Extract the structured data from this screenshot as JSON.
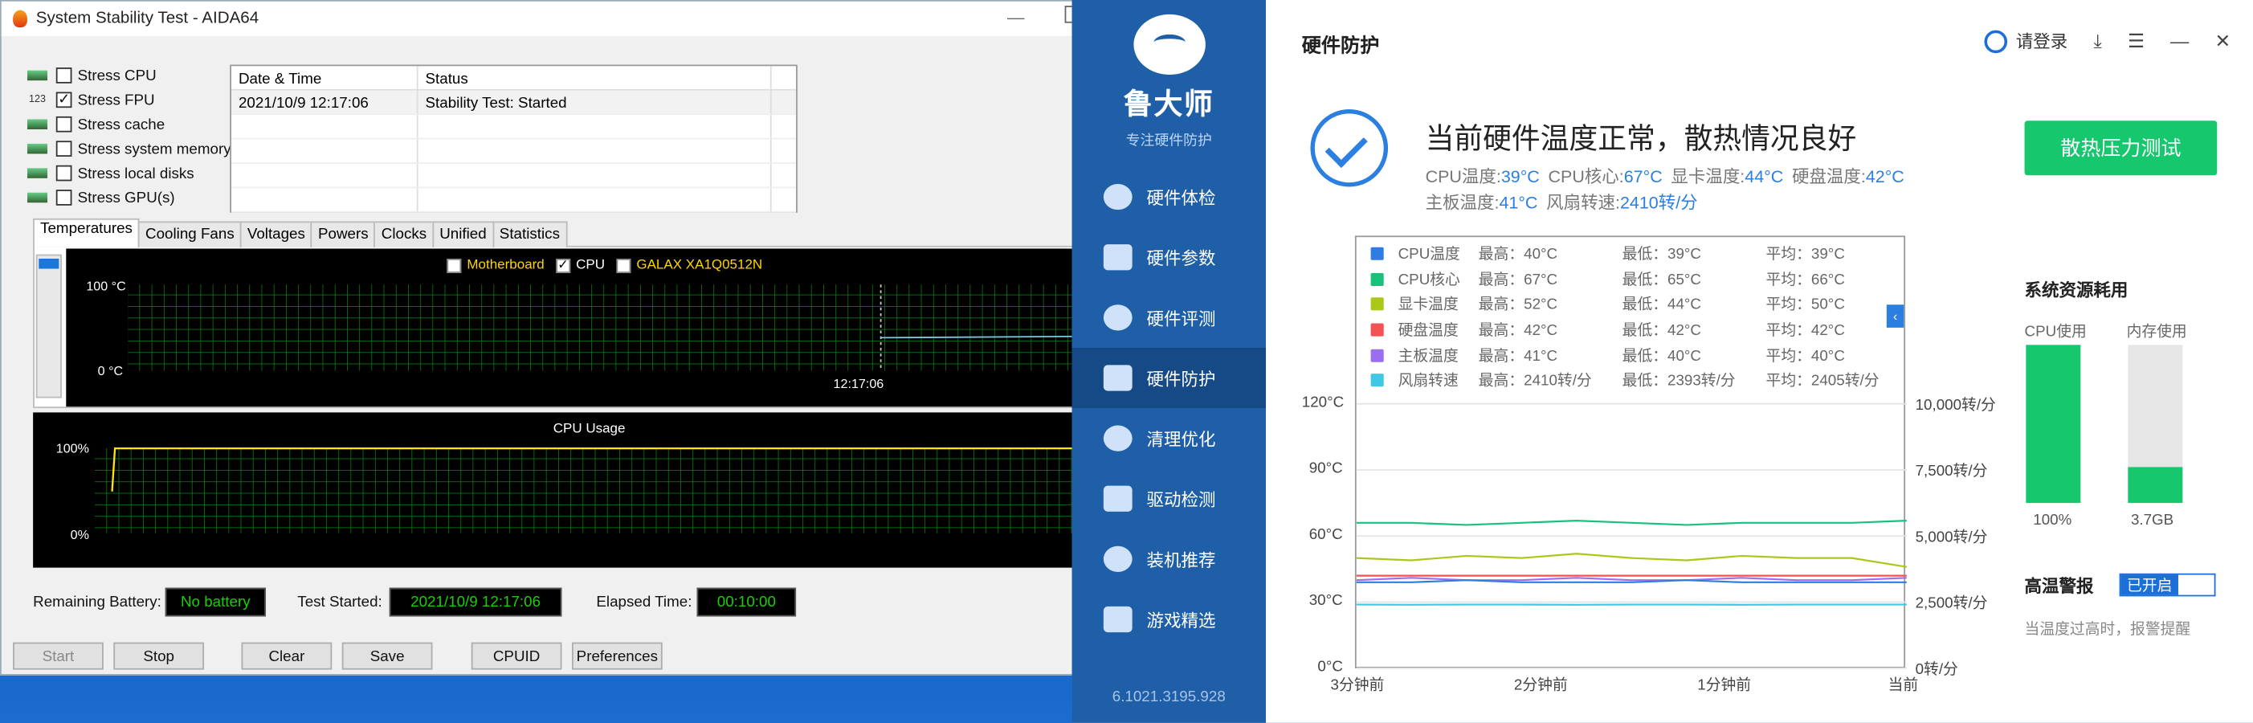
{
  "aida": {
    "title": "System Stability Test - AIDA64",
    "stress_options": [
      {
        "label": "Stress CPU",
        "checked": false,
        "icon": "cpu-chip-icon"
      },
      {
        "label": "Stress FPU",
        "checked": true,
        "icon": "fpu-icon",
        "icon_text": "123"
      },
      {
        "label": "Stress cache",
        "checked": false,
        "icon": "cache-chip-icon"
      },
      {
        "label": "Stress system memory",
        "checked": false,
        "icon": "memory-module-icon"
      },
      {
        "label": "Stress local disks",
        "checked": false,
        "icon": "disk-icon"
      },
      {
        "label": "Stress GPU(s)",
        "checked": false,
        "icon": "gpu-icon"
      }
    ],
    "log": {
      "col_date": "Date & Time",
      "col_status": "Status",
      "rows": [
        {
          "date": "2021/10/9 12:17:06",
          "status": "Stability Test: Started"
        }
      ]
    },
    "tabs": [
      "Temperatures",
      "Cooling Fans",
      "Voltages",
      "Powers",
      "Clocks",
      "Unified",
      "Statistics"
    ],
    "temp_graph": {
      "legend": [
        {
          "label": "Motherboard",
          "checked": false
        },
        {
          "label": "CPU",
          "checked": true
        },
        {
          "label": "GALAX XA1Q0512N",
          "checked": false
        }
      ],
      "y_max": "100 °C",
      "y_min": "0 °C",
      "time_label": "12:17:06"
    },
    "usage_graph": {
      "title": "CPU Usage",
      "y_max": "100%",
      "y_min": "0%"
    },
    "battery_label": "Remaining Battery:",
    "battery_value": "No battery",
    "started_label": "Test Started:",
    "started_value": "2021/10/9 12:17:06",
    "elapsed_label": "Elapsed Time:",
    "elapsed_value": "00:10:00",
    "buttons": {
      "start": "Start",
      "stop": "Stop",
      "clear": "Clear",
      "save": "Save",
      "cpuid": "CPUID",
      "prefs": "Preferences"
    }
  },
  "ludashi": {
    "brand": "鲁大师",
    "slogan": "专注硬件防护",
    "nav": [
      "硬件体检",
      "硬件参数",
      "硬件评测",
      "硬件防护",
      "清理优化",
      "驱动检测",
      "装机推荐",
      "游戏精选"
    ],
    "active_nav": 3,
    "version": "6.1021.3195.928",
    "page_title": "硬件防护",
    "login": "请登录",
    "status": "当前硬件温度正常，散热情况良好",
    "readings": [
      {
        "label": "CPU温度:",
        "value": "39°C"
      },
      {
        "label": "CPU核心:",
        "value": "67°C"
      },
      {
        "label": "显卡温度:",
        "value": "44°C"
      },
      {
        "label": "硬盘温度:",
        "value": "42°C"
      },
      {
        "label": "主板温度:",
        "value": "41°C"
      },
      {
        "label": "风扇转速:",
        "value": "2410转/分"
      }
    ],
    "stress_button": "散热压力测试",
    "sensor_table": [
      {
        "name": "CPU温度",
        "max": "最高：40°C",
        "min": "最低：39°C",
        "avg": "平均：39°C",
        "color": "#2f7de1"
      },
      {
        "name": "CPU核心",
        "max": "最高：67°C",
        "min": "最低：65°C",
        "avg": "平均：66°C",
        "color": "#18c27c"
      },
      {
        "name": "显卡温度",
        "max": "最高：52°C",
        "min": "最低：44°C",
        "avg": "平均：50°C",
        "color": "#a9c81a"
      },
      {
        "name": "硬盘温度",
        "max": "最高：42°C",
        "min": "最低：42°C",
        "avg": "平均：42°C",
        "color": "#f25252"
      },
      {
        "name": "主板温度",
        "max": "最高：41°C",
        "min": "最低：40°C",
        "avg": "平均：40°C",
        "color": "#9b6ef0"
      },
      {
        "name": "风扇转速",
        "max": "最高：2410转/分",
        "min": "最低：2393转/分",
        "avg": "平均：2405转/分",
        "color": "#3fc8e6"
      }
    ],
    "resources_title": "系统资源耗用",
    "cpu_label": "CPU使用",
    "mem_label": "内存使用",
    "cpu_value": "100%",
    "cpu_fraction": 1.0,
    "mem_value": "3.7GB",
    "mem_fraction": 0.23,
    "alarm_title": "高温警报",
    "alarm_toggle": "已开启",
    "alarm_hint": "当温度过高时，报警提醒"
  },
  "chart_data": {
    "type": "line",
    "x": [
      "3分钟前",
      "2分钟前",
      "1分钟前",
      "当前"
    ],
    "y_left_ticks": [
      "0°C",
      "30°C",
      "60°C",
      "90°C",
      "120°C"
    ],
    "y_right_ticks": [
      "0转/分",
      "2,500转/分",
      "5,000转/分",
      "7,500转/分",
      "10,000转/分"
    ],
    "ylim_left": [
      0,
      120
    ],
    "ylim_right": [
      0,
      10000
    ],
    "series": [
      {
        "name": "CPU核心",
        "values": [
          66,
          66,
          65,
          66,
          67,
          66,
          65,
          66,
          66,
          66,
          67
        ],
        "color": "#18c27c"
      },
      {
        "name": "显卡温度",
        "values": [
          50,
          49,
          51,
          50,
          52,
          50,
          49,
          51,
          50,
          50,
          46
        ],
        "color": "#a9c81a"
      },
      {
        "name": "硬盘温度",
        "values": [
          42,
          42,
          42,
          42,
          42,
          42,
          42,
          42,
          42,
          42,
          42
        ],
        "color": "#f25252"
      },
      {
        "name": "主板温度",
        "values": [
          40,
          41,
          40,
          40,
          41,
          40,
          40,
          41,
          40,
          40,
          41
        ],
        "color": "#9b6ef0"
      },
      {
        "name": "CPU温度",
        "values": [
          39,
          39,
          40,
          39,
          39,
          39,
          40,
          39,
          39,
          39,
          39
        ],
        "color": "#2f7de1"
      },
      {
        "name": "风扇转速",
        "values": [
          2405,
          2400,
          2410,
          2405,
          2400,
          2410,
          2405,
          2400,
          2405,
          2410,
          2405
        ],
        "color": "#3fc8e6"
      }
    ]
  }
}
